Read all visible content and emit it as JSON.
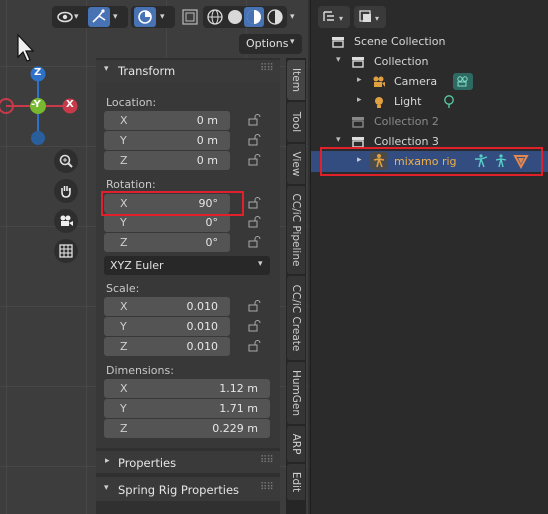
{
  "viewport": {
    "header": {
      "options_label": "Options"
    },
    "gizmo": {
      "z": "Z",
      "y": "-Y",
      "x": "X"
    }
  },
  "panel": {
    "transform_title": "Transform",
    "location": {
      "label": "Location:",
      "rows": [
        {
          "axis": "X",
          "value": "0 m"
        },
        {
          "axis": "Y",
          "value": "0 m"
        },
        {
          "axis": "Z",
          "value": "0 m"
        }
      ]
    },
    "rotation": {
      "label": "Rotation:",
      "rows": [
        {
          "axis": "X",
          "value": "90°"
        },
        {
          "axis": "Y",
          "value": "0°"
        },
        {
          "axis": "Z",
          "value": "0°"
        }
      ],
      "mode": "XYZ Euler"
    },
    "scale": {
      "label": "Scale:",
      "rows": [
        {
          "axis": "X",
          "value": "0.010"
        },
        {
          "axis": "Y",
          "value": "0.010"
        },
        {
          "axis": "Z",
          "value": "0.010"
        }
      ]
    },
    "dimensions": {
      "label": "Dimensions:",
      "rows": [
        {
          "axis": "X",
          "value": "1.12 m"
        },
        {
          "axis": "Y",
          "value": "1.71 m"
        },
        {
          "axis": "Z",
          "value": "0.229 m"
        }
      ]
    },
    "properties_title": "Properties",
    "spring_title": "Spring Rig Properties"
  },
  "tabs": [
    "Item",
    "Tool",
    "View",
    "CC/iC Pipeline",
    "CC/iC Create",
    "HumGen",
    "ARP",
    "Edit"
  ],
  "outliner": {
    "scene_collection": "Scene Collection",
    "collection": "Collection",
    "camera": "Camera",
    "light": "Light",
    "collection2": "Collection 2",
    "collection3": "Collection 3",
    "mixamo": "mixamo rig"
  },
  "colors": {
    "highlight_red": "#e0202a",
    "selected_row": "#334d80",
    "object_orange": "#e0a040"
  }
}
